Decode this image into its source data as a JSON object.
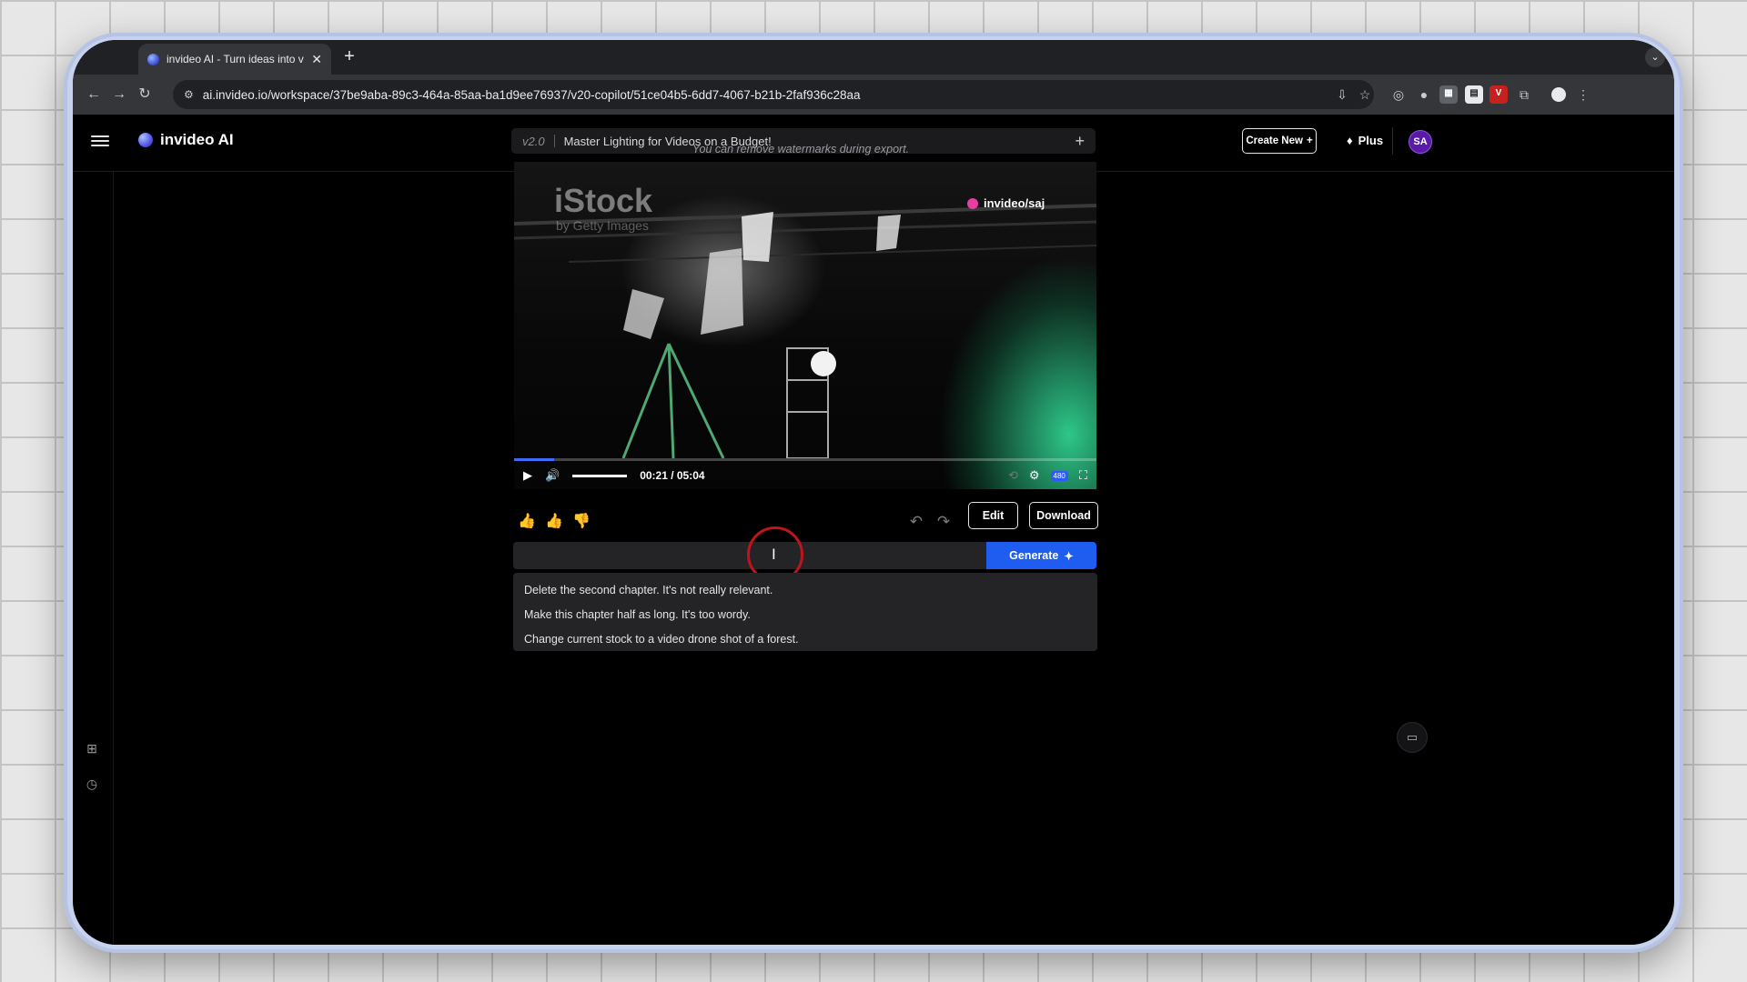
{
  "browser": {
    "tab_title": "invideo AI - Turn ideas into vi",
    "tab_close": "✕",
    "new_tab": "+",
    "url": "ai.invideo.io/workspace/37be9aba-89c3-464a-85aa-ba1d9ee76937/v20-copilot/51ce04b5-6dd7-4067-b21b-2faf936c28aa",
    "back": "←",
    "forward": "→",
    "reload": "↻",
    "extensions": [
      "install-icon",
      "bookmark-star-icon",
      "ext-1-icon",
      "ext-2-icon",
      "ext-3-icon",
      "ext-4-icon",
      "ext-v-icon",
      "puzzle-icon",
      "profile-icon",
      "menu-icon"
    ],
    "ext_v_label": "V"
  },
  "header": {
    "brand": "invideo AI",
    "version": "v2.0",
    "project_title": "Master Lighting for Videos on a Budget!",
    "project_add": "+",
    "create_new": "Create New",
    "create_new_icon": "+",
    "plan_label": "Plus",
    "plan_icon": "♦",
    "avatar_initials": "SA"
  },
  "main": {
    "notice": "You can remove watermarks during export.",
    "video": {
      "watermark_istock": "iStock",
      "watermark_getty": "by Getty Images",
      "watermark_invideo": "invideo/saj",
      "time": "00:21 / 05:04",
      "progress_fraction": 0.069,
      "volume_fraction": 1.0,
      "quality_badge": "480"
    },
    "actions": {
      "edit": "Edit",
      "download": "Download",
      "generate": "Generate",
      "generate_icon": "✦"
    },
    "prompt_value": "",
    "suggestions": [
      "Delete the second chapter. It's not really relevant.",
      "Make this chapter half as long. It's too wordy.",
      "Change current stock to a video drone shot of a forest."
    ]
  },
  "colors": {
    "accent": "#1f5cf0",
    "background": "#000000",
    "avatar": "#5a1aa8",
    "highlight_ring": "#c0141c"
  }
}
